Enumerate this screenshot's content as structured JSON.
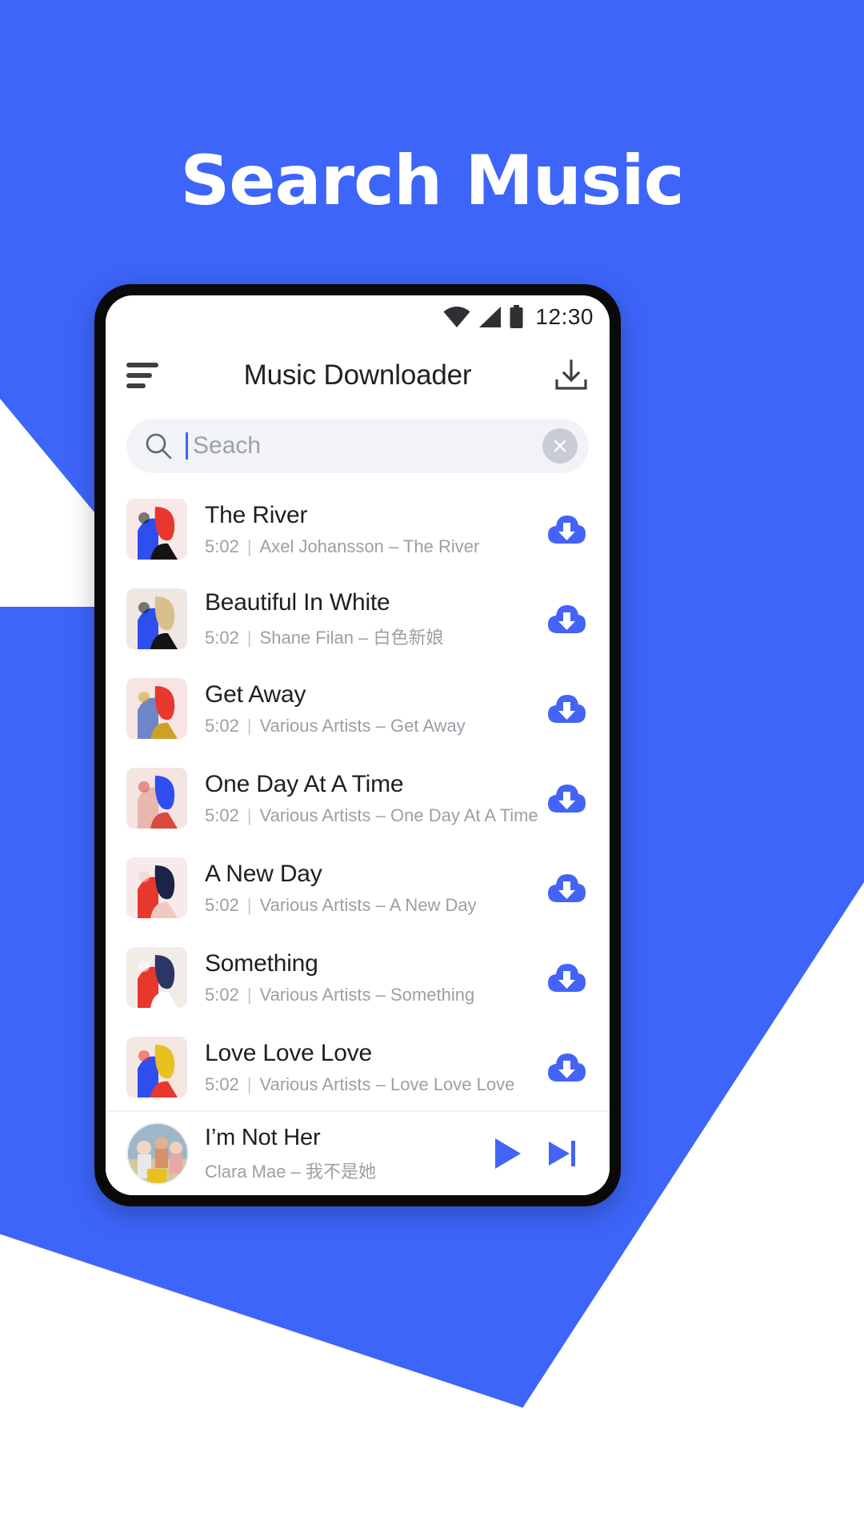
{
  "hero": {
    "title": "Search Music",
    "bg_color": "#3d65fa"
  },
  "statusbar": {
    "wifi_icon": "wifi-icon",
    "signal_icon": "cellular-signal-icon",
    "battery_icon": "battery-icon",
    "time": "12:30"
  },
  "appbar": {
    "menu_icon": "hamburger-menu-icon",
    "title": "Music Downloader",
    "download_icon": "download-tray-icon"
  },
  "search": {
    "search_icon": "search-icon",
    "value": "",
    "placeholder": "Seach",
    "clear_icon": "close-circle-icon",
    "caret_color": "#3d65fa"
  },
  "songs": [
    {
      "title": "The River",
      "duration": "5:02",
      "artist": "Axel Johansson",
      "album": "The River",
      "download_icon": "cloud-download-icon",
      "cover": {
        "bg": "#f7e9e7",
        "a": "#e8372c",
        "b": "#2f4ef0",
        "c": "#141414"
      }
    },
    {
      "title": "Beautiful In White",
      "duration": "5:02",
      "artist": "Shane Filan",
      "album": "白色新娘",
      "download_icon": "cloud-download-icon",
      "cover": {
        "bg": "#efe7e2",
        "a": "#d8c08b",
        "b": "#2f4ef0",
        "c": "#141414"
      }
    },
    {
      "title": "Get Away",
      "duration": "5:02",
      "artist": "Various Artists",
      "album": "Get Away",
      "download_icon": "cloud-download-icon",
      "cover": {
        "bg": "#f6e5e2",
        "a": "#e8372c",
        "b": "#6d86c8",
        "c": "#c9a227"
      }
    },
    {
      "title": "One Day At  A Time",
      "duration": "5:02",
      "artist": "Various Artists",
      "album": "One Day At A Time",
      "download_icon": "cloud-download-icon",
      "cover": {
        "bg": "#f4e4e2",
        "a": "#2f4ef0",
        "b": "#e8b7ae",
        "c": "#d84a3d"
      }
    },
    {
      "title": "A New Day",
      "duration": "5:02",
      "artist": "Various Artists",
      "album": "A New Day",
      "download_icon": "cloud-download-icon",
      "cover": {
        "bg": "#f7eae8",
        "a": "#1b2347",
        "b": "#e8372c",
        "c": "#f0c9c2"
      }
    },
    {
      "title": "Something",
      "duration": "5:02",
      "artist": "Various Artists",
      "album": "Something",
      "download_icon": "cloud-download-icon",
      "cover": {
        "bg": "#f2ece6",
        "a": "#2c3566",
        "b": "#e8372c",
        "c": "#ffffff"
      }
    },
    {
      "title": "Love Love Love",
      "duration": "5:02",
      "artist": "Various Artists",
      "album": "Love Love Love",
      "download_icon": "cloud-download-icon",
      "cover": {
        "bg": "#f4e6e1",
        "a": "#e8c020",
        "b": "#2f4ef0",
        "c": "#e8372c"
      }
    }
  ],
  "player": {
    "title": "I’m Not Her",
    "artist": "Clara Mae",
    "album": "我不是她",
    "play_icon": "play-icon",
    "next_icon": "skip-next-icon",
    "accent_color": "#3d65fa"
  },
  "separator": "–",
  "meta_divider": "|"
}
